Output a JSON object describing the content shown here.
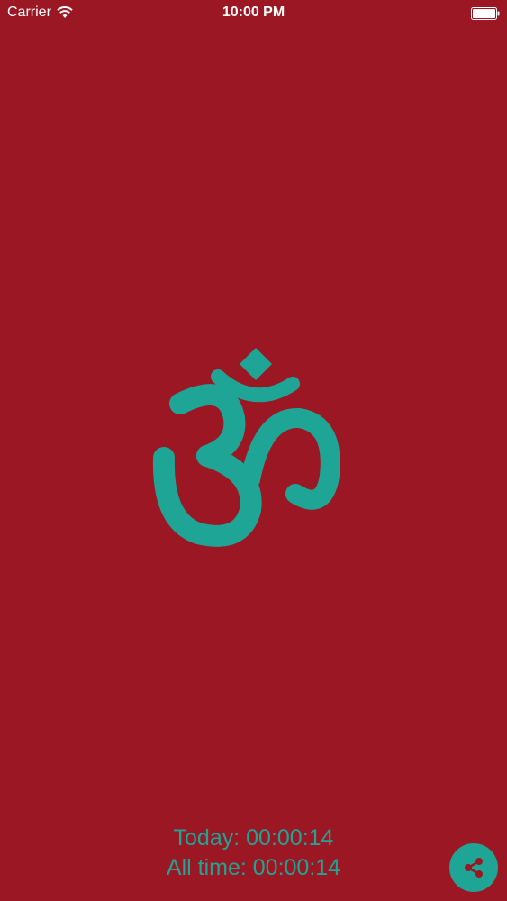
{
  "status_bar": {
    "carrier": "Carrier",
    "time": "10:00 PM",
    "wifi_icon": "wifi-icon",
    "battery_icon": "battery-icon"
  },
  "main": {
    "symbol_icon": "om-symbol-icon",
    "symbol_color": "#1ea595",
    "background_color": "#9b1723"
  },
  "stats": {
    "today": "Today: 00:00:14",
    "all_time": "All time: 00:00:14"
  },
  "share": {
    "icon": "share-icon",
    "color": "#1ea595"
  }
}
